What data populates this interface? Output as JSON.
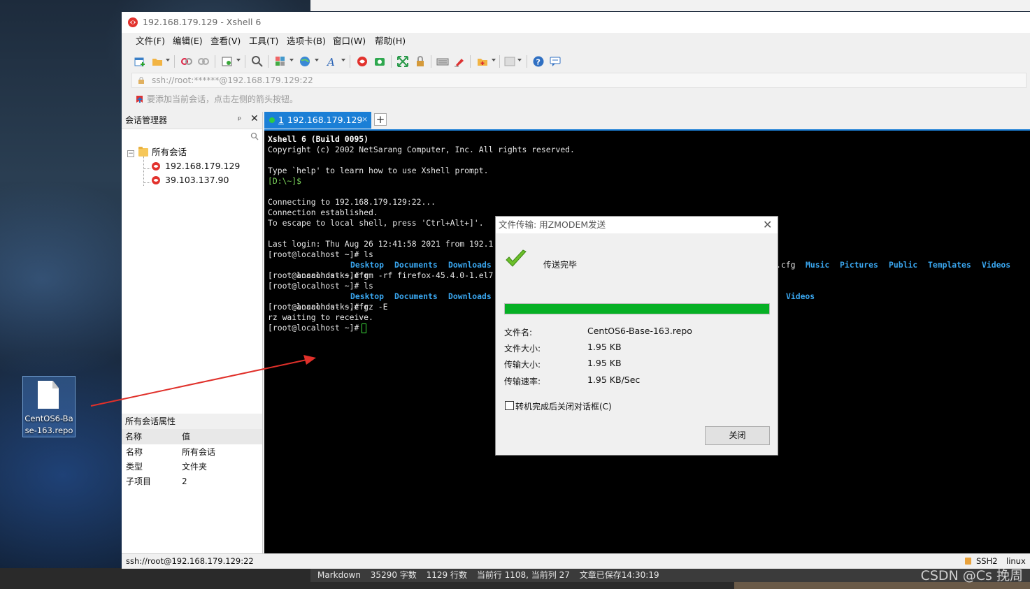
{
  "window": {
    "title": "192.168.179.129 - Xshell 6"
  },
  "menu": [
    "文件(F)",
    "编辑(E)",
    "查看(V)",
    "工具(T)",
    "选项卡(B)",
    "窗口(W)",
    "帮助(H)"
  ],
  "address": {
    "value": "ssh://root:******@192.168.179.129:22"
  },
  "hint": {
    "text": "要添加当前会话，点击左侧的箭头按钮。"
  },
  "session_manager": {
    "title": "会话管理器",
    "pin": "ᵖ",
    "close": "✕",
    "root": "所有会话",
    "items": [
      "192.168.179.129",
      "39.103.137.90"
    ]
  },
  "properties": {
    "title": "所有会话属性",
    "col_name": "名称",
    "col_value": "值",
    "rows": [
      {
        "k": "名称",
        "v": "所有会话"
      },
      {
        "k": "类型",
        "v": "文件夹"
      },
      {
        "k": "子项目",
        "v": "2"
      }
    ]
  },
  "tab": {
    "num": "1",
    "label": " 192.168.179.129",
    "close": "×",
    "add": "+"
  },
  "terminal": {
    "lines": [
      "Xshell 6 (Build 0095)",
      "Copyright (c) 2002 NetSarang Computer, Inc. All rights reserved.",
      "",
      "Type `help' to learn how to use Xshell prompt.",
      "[D:\\~]$",
      "",
      "Connecting to 192.168.179.129:22...",
      "Connection established.",
      "To escape to local shell, press 'Ctrl+Alt+]'.",
      "",
      "Last login: Thu Aug 26 12:41:58 2021 from 192.1",
      "[root@localhost ~]# ls",
      "anaconda-ks.cfg",
      "[root@localhost ~]# rm -rf firefox-45.4.0-1.el7",
      "[root@localhost ~]# ls",
      "anaconda-ks.cfg",
      "[root@localhost ~]# rz -E",
      "rz waiting to receive.",
      "[root@localhost ~]# "
    ],
    "ls1_dirs": [
      "Desktop",
      "Documents",
      "Downloads"
    ],
    "ls1_right_prefix": ".cfg",
    "ls1_right": [
      "Music",
      "Pictures",
      "Public",
      "Templates",
      "Videos"
    ],
    "ls2_dirs": [
      "Desktop",
      "Documents",
      "Downloads"
    ],
    "ls2_right": [
      "Videos"
    ]
  },
  "dialog": {
    "title": "文件传输: 用ZMODEM发送",
    "close": "✕",
    "message": "传送完毕",
    "progress": 1.0,
    "fields": [
      {
        "k": "文件名:",
        "v": "CentOS6-Base-163.repo"
      },
      {
        "k": "文件大小:",
        "v": "1.95 KB"
      },
      {
        "k": "传输大小:",
        "v": "1.95 KB"
      },
      {
        "k": "传输速率:",
        "v": "1.95 KB/Sec"
      }
    ],
    "checkbox": "转机完成后关闭对话框(C)",
    "button": "关闭"
  },
  "statusbar": {
    "left": "ssh://root@192.168.179.129:22",
    "proto": "SSH2",
    "os": "linux"
  },
  "desktop_icon": {
    "name": "CentOS6-Base-163.repo"
  },
  "editor_status": [
    "Markdown",
    "35290 字数",
    "1129 行数",
    "当前行 1108, 当前列 27",
    "文章已保存14:30:19"
  ],
  "watermark": "CSDN @Cs 挽周"
}
